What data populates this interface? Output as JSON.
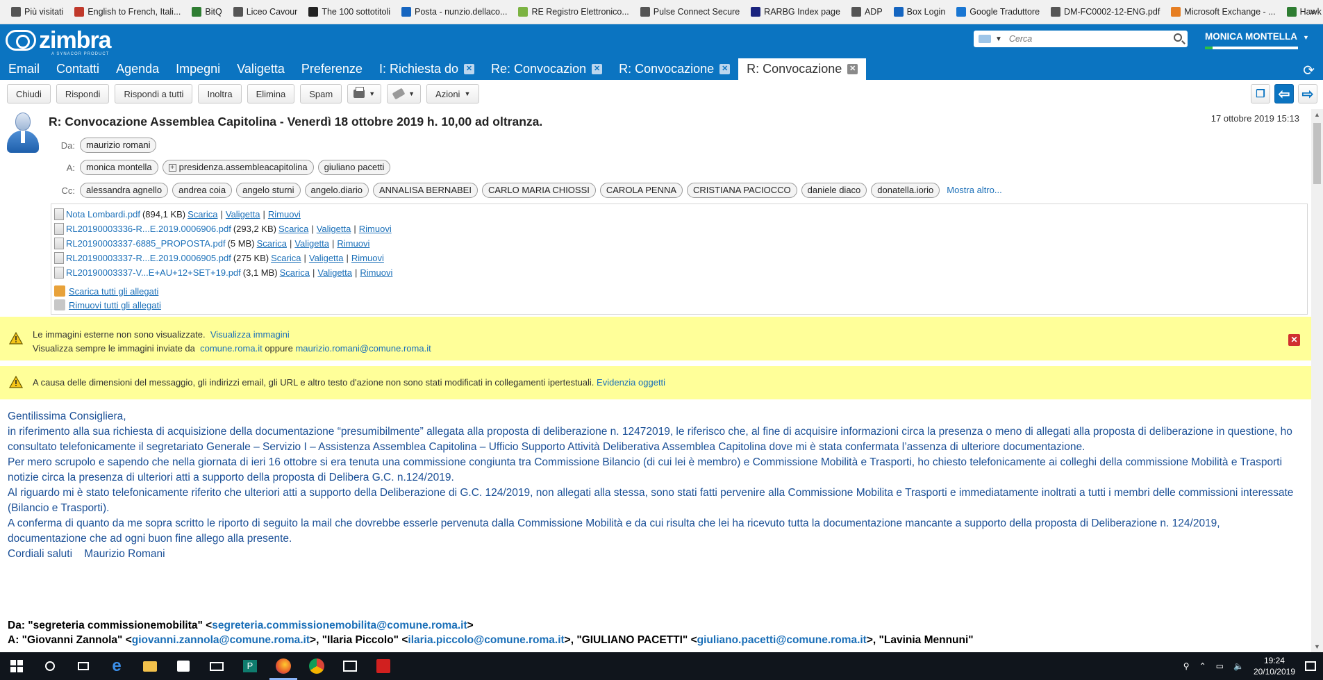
{
  "bookmarks": [
    {
      "label": "Più visitati",
      "icon": "gear-icon",
      "color": "#555555"
    },
    {
      "label": "English to French, Itali...",
      "icon": "wordreference-icon",
      "color": "#c0392b"
    },
    {
      "label": "BitQ",
      "icon": "bitq-icon",
      "color": "#2e7d32"
    },
    {
      "label": "Liceo Cavour",
      "icon": "school-icon",
      "color": "#555555"
    },
    {
      "label": "The 100 sottotitoli",
      "icon": "subtitles-icon",
      "color": "#222222"
    },
    {
      "label": "Posta - nunzio.dellaco...",
      "icon": "outlook-icon",
      "color": "#1565c0"
    },
    {
      "label": "RE Registro Elettronico...",
      "icon": "registro-icon",
      "color": "#7cb342"
    },
    {
      "label": "Pulse Connect Secure",
      "icon": "globe-icon",
      "color": "#555555"
    },
    {
      "label": "RARBG Index page",
      "icon": "rarbg-icon",
      "color": "#1a237e"
    },
    {
      "label": "ADP",
      "icon": "globe-icon",
      "color": "#555555"
    },
    {
      "label": "Box Login",
      "icon": "box-icon",
      "color": "#1565c0"
    },
    {
      "label": "Google Traduttore",
      "icon": "translate-icon",
      "color": "#1976d2"
    },
    {
      "label": "DM-FC0002-12-ENG.pdf",
      "icon": "globe-icon",
      "color": "#555555"
    },
    {
      "label": "Microsoft Exchange - ...",
      "icon": "exchange-icon",
      "color": "#e67e22"
    },
    {
      "label": "Hawk Legend Downlo...",
      "icon": "hawk-icon",
      "color": "#2e7d32"
    }
  ],
  "header": {
    "logo_text": "zimbra",
    "logo_sub": "A SYNACOR PRODUCT",
    "search_placeholder": "Cerca",
    "user_name": "MONICA MONTELLA",
    "quota_fraction": 0.08
  },
  "app_tabs": [
    {
      "label": "Email"
    },
    {
      "label": "Contatti"
    },
    {
      "label": "Agenda"
    },
    {
      "label": "Impegni"
    },
    {
      "label": "Valigetta"
    },
    {
      "label": "Preferenze"
    },
    {
      "label": "I: Richiesta do",
      "closable": true
    },
    {
      "label": "Re: Convocazion",
      "closable": true
    },
    {
      "label": "R: Convocazione",
      "closable": true
    },
    {
      "label": "R: Convocazione",
      "closable": true,
      "active": true
    }
  ],
  "toolbar": {
    "close": "Chiudi",
    "reply": "Rispondi",
    "reply_all": "Rispondi a tutti",
    "forward": "Inoltra",
    "delete": "Elimina",
    "spam": "Spam",
    "actions": "Azioni"
  },
  "message": {
    "subject": "R: Convocazione Assemblea Capitolina - Venerdì 18 ottobre 2019 h. 10,00 ad oltranza.",
    "date": "17 ottobre 2019 15:13",
    "from_label": "Da:",
    "to_label": "A:",
    "cc_label": "Cc:",
    "from": [
      "maurizio romani"
    ],
    "to": [
      "monica montella",
      "presidenza.assembleacapitolina",
      "giuliano pacetti"
    ],
    "cc": [
      "alessandra agnello",
      "andrea coia",
      "angelo sturni",
      "angelo.diario",
      "ANNALISA BERNABEI",
      "CARLO MARIA CHIOSSI",
      "CAROLA PENNA",
      "CRISTIANA PACIOCCO",
      "daniele diaco",
      "donatella.iorio"
    ],
    "show_more": "Mostra altro..."
  },
  "attachments": {
    "items": [
      {
        "name": "Nota Lombardi.pdf",
        "size": "(894,1 KB)"
      },
      {
        "name": "RL20190003336-R...E.2019.0006906.pdf",
        "size": "(293,2 KB)"
      },
      {
        "name": "RL20190003337-6885_PROPOSTA.pdf",
        "size": "(5 MB)"
      },
      {
        "name": "RL20190003337-R...E.2019.0006905.pdf",
        "size": "(275 KB)"
      },
      {
        "name": "RL20190003337-V...E+AU+12+SET+19.pdf",
        "size": "(3,1 MB)"
      }
    ],
    "download": "Scarica",
    "briefcase": "Valigetta",
    "remove": "Rimuovi",
    "sep": "|",
    "download_all": "Scarica tutti gli allegati",
    "remove_all": "Rimuovi tutti gli allegati"
  },
  "banners": {
    "images_line1": "Le immagini esterne non sono visualizzate.",
    "images_link": "Visualizza immagini",
    "images_line2": "Visualizza sempre le immagini inviate da",
    "images_domain": "comune.roma.it",
    "images_or": "oppure",
    "images_email": "maurizio.romani@comune.roma.it",
    "size_notice": "A causa delle dimensioni del messaggio, gli indirizzi email, gli URL e altro testo d'azione non sono stati modificati in collegamenti ipertestuali.",
    "size_link": "Evidenzia oggetti"
  },
  "body": {
    "p1": "Gentilissima Consigliera,",
    "p2": "in riferimento alla sua richiesta di acquisizione della documentazione “presumibilmente” allegata alla proposta di deliberazione n. 12472019, le riferisco che,  al fine di acquisire informazioni circa la presenza o meno di allegati alla proposta di deliberazione in questione, ho consultato telefonicamente il segretariato Generale – Servizio I – Assistenza Assemblea Capitolina – Ufficio Supporto Attività Deliberativa Assemblea Capitolina dove mi è stata confermata l’assenza di ulteriore documentazione.",
    "p3": "Per mero scrupolo e sapendo che nella giornata di ieri 16 ottobre si era tenuta una commissione congiunta tra Commissione Bilancio (di cui lei è membro) e Commissione Mobilità e Trasporti,  ho chiesto telefonicamente ai colleghi della commissione Mobilità e Trasporti notizie circa la presenza di ulteriori atti a supporto della proposta di Delibera G.C. n.124/2019.",
    "p4": "Al riguardo mi è stato telefonicamente riferito che ulteriori atti a supporto della Deliberazione di G.C. 124/2019, non allegati alla stessa, sono stati fatti pervenire alla Commissione Mobilita e Trasporti e immediatamente inoltrati a tutti i membri delle commissioni interessate (Bilancio e Trasporti).",
    "p5": "A conferma di quanto da me sopra scritto le riporto di seguito la mail che dovrebbe esserle pervenuta dalla Commissione Mobilità e da cui risulta che lei ha ricevuto tutta la documentazione mancante a supporto della proposta di Deliberazione n. 124/2019, documentazione che ad ogni buon fine allego alla presente.",
    "p6": "Cordiali saluti    Maurizio Romani"
  },
  "quoted": {
    "from_prefix": "Da: \"segreteria commissionemobilita\" <",
    "from_email": "segreteria.commissionemobilita@comune.roma.it",
    "from_suffix": ">",
    "to_prefix": "A: \"Giovanni Zannola\" <",
    "to_email1": "giovanni.zannola@comune.roma.it",
    "to_mid1": ">, \"Ilaria Piccolo\" <",
    "to_email2": "ilaria.piccolo@comune.roma.it",
    "to_mid2": ">, \"GIULIANO PACETTI\" <",
    "to_email3": "giuliano.pacetti@comune.roma.it",
    "to_mid3": ">, \"Lavinia Mennuni\""
  },
  "taskbar": {
    "time": "19:24",
    "date": "20/10/2019"
  }
}
